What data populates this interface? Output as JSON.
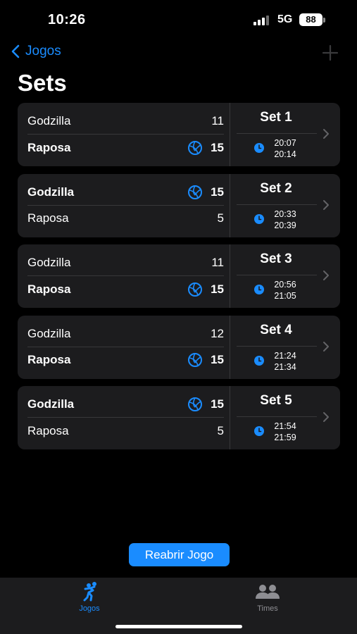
{
  "status": {
    "time": "10:26",
    "network": "5G",
    "battery": "88"
  },
  "nav": {
    "back_label": "Jogos"
  },
  "page": {
    "title": "Sets"
  },
  "sets": [
    {
      "label": "Set 1",
      "team1": {
        "name": "Godzilla",
        "score": "11"
      },
      "team2": {
        "name": "Raposa",
        "score": "15"
      },
      "winner": 2,
      "start": "20:07",
      "end": "20:14"
    },
    {
      "label": "Set 2",
      "team1": {
        "name": "Godzilla",
        "score": "15"
      },
      "team2": {
        "name": "Raposa",
        "score": "5"
      },
      "winner": 1,
      "start": "20:33",
      "end": "20:39"
    },
    {
      "label": "Set 3",
      "team1": {
        "name": "Godzilla",
        "score": "11"
      },
      "team2": {
        "name": "Raposa",
        "score": "15"
      },
      "winner": 2,
      "start": "20:56",
      "end": "21:05"
    },
    {
      "label": "Set 4",
      "team1": {
        "name": "Godzilla",
        "score": "12"
      },
      "team2": {
        "name": "Raposa",
        "score": "15"
      },
      "winner": 2,
      "start": "21:24",
      "end": "21:34"
    },
    {
      "label": "Set 5",
      "team1": {
        "name": "Godzilla",
        "score": "15"
      },
      "team2": {
        "name": "Raposa",
        "score": "5"
      },
      "winner": 1,
      "start": "21:54",
      "end": "21:59"
    }
  ],
  "actions": {
    "reopen_label": "Reabrir Jogo"
  },
  "tabs": [
    {
      "label": "Jogos",
      "icon": "volleyball-player-icon",
      "active": true
    },
    {
      "label": "Times",
      "icon": "people-icon",
      "active": false
    }
  ],
  "colors": {
    "accent": "#1a8cff",
    "card": "#1c1c1e",
    "background": "#000000",
    "inactive": "#8e8e93"
  }
}
